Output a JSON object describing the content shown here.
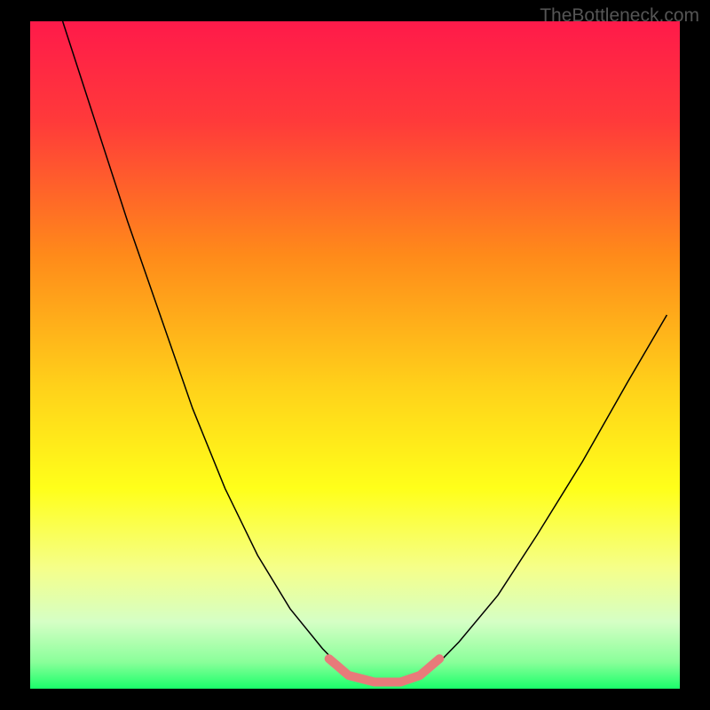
{
  "watermark": "TheBottleneck.com",
  "chart_data": {
    "type": "line",
    "title": "",
    "xlabel": "",
    "ylabel": "",
    "xlim": [
      0,
      100
    ],
    "ylim": [
      0,
      100
    ],
    "background": {
      "type": "vertical-gradient",
      "stops": [
        {
          "offset": 0,
          "color": "#ff1a4a"
        },
        {
          "offset": 15,
          "color": "#ff3a3a"
        },
        {
          "offset": 35,
          "color": "#ff8a1a"
        },
        {
          "offset": 55,
          "color": "#ffd21a"
        },
        {
          "offset": 70,
          "color": "#ffff1a"
        },
        {
          "offset": 82,
          "color": "#f5ff8a"
        },
        {
          "offset": 90,
          "color": "#d5ffc5"
        },
        {
          "offset": 96,
          "color": "#8aff9a"
        },
        {
          "offset": 100,
          "color": "#1aff6a"
        }
      ]
    },
    "series": [
      {
        "name": "curve",
        "stroke": "#000000",
        "stroke_width": 1.5,
        "points": [
          {
            "x": 5,
            "y": 100
          },
          {
            "x": 10,
            "y": 85
          },
          {
            "x": 15,
            "y": 70
          },
          {
            "x": 20,
            "y": 56
          },
          {
            "x": 25,
            "y": 42
          },
          {
            "x": 30,
            "y": 30
          },
          {
            "x": 35,
            "y": 20
          },
          {
            "x": 40,
            "y": 12
          },
          {
            "x": 45,
            "y": 6
          },
          {
            "x": 48,
            "y": 3
          },
          {
            "x": 52,
            "y": 1
          },
          {
            "x": 58,
            "y": 1
          },
          {
            "x": 62,
            "y": 3
          },
          {
            "x": 66,
            "y": 7
          },
          {
            "x": 72,
            "y": 14
          },
          {
            "x": 78,
            "y": 23
          },
          {
            "x": 85,
            "y": 34
          },
          {
            "x": 92,
            "y": 46
          },
          {
            "x": 98,
            "y": 56
          }
        ]
      },
      {
        "name": "optimal-zone",
        "stroke": "#e87a7a",
        "stroke_width": 10,
        "linecap": "round",
        "points": [
          {
            "x": 46,
            "y": 4.5
          },
          {
            "x": 49,
            "y": 2
          },
          {
            "x": 53,
            "y": 1
          },
          {
            "x": 57,
            "y": 1
          },
          {
            "x": 60,
            "y": 2
          },
          {
            "x": 63,
            "y": 4.5
          }
        ]
      }
    ]
  }
}
